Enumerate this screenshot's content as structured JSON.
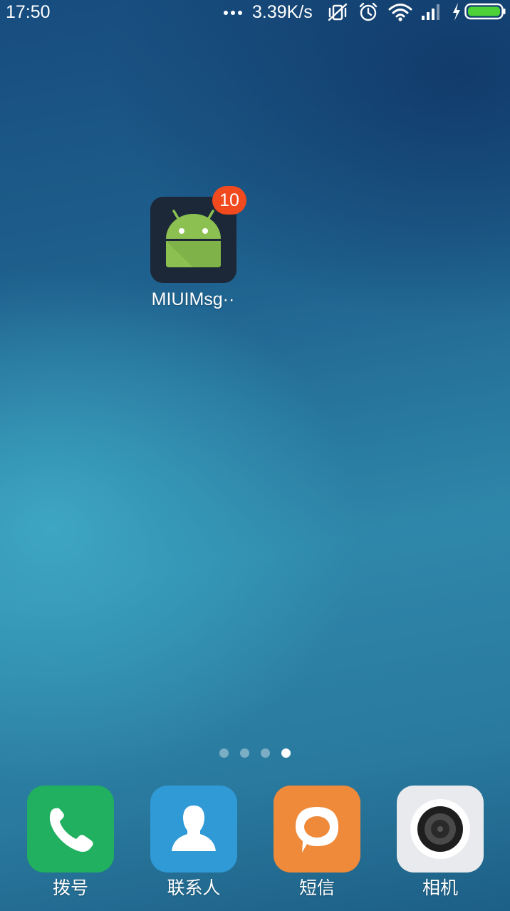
{
  "status_bar": {
    "time": "17:50",
    "network_speed": "3.39K/s",
    "icons": [
      "more-dots-icon",
      "vibrate-off-icon",
      "alarm-icon",
      "wifi-icon",
      "cellular-signal-icon",
      "charging-icon",
      "battery-icon"
    ],
    "battery_color": "#4cd137"
  },
  "desktop": {
    "apps": [
      {
        "label": "MIUIMsg··",
        "badge": "10",
        "icon": "android-icon",
        "badge_color": "#f04a1e"
      }
    ]
  },
  "page_indicator": {
    "pages": 4,
    "active_index": 3
  },
  "dock": {
    "items": [
      {
        "label": "拨号",
        "icon": "phone-icon",
        "color": "#20b05f"
      },
      {
        "label": "联系人",
        "icon": "contacts-icon",
        "color": "#2f9ad6"
      },
      {
        "label": "短信",
        "icon": "message-icon",
        "color": "#ef8a3b"
      },
      {
        "label": "相机",
        "icon": "camera-icon",
        "color": "#e8eaed"
      }
    ]
  }
}
